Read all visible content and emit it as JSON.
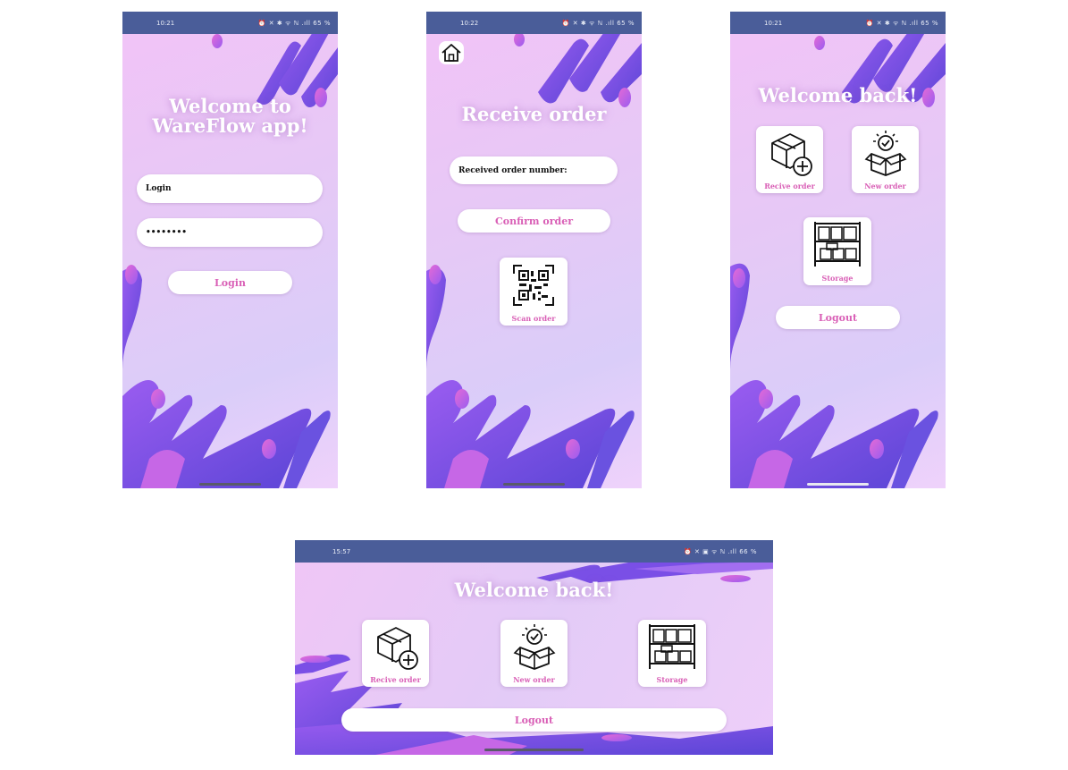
{
  "screens": {
    "login": {
      "time": "10:21",
      "status_icons": "⏰ ✕ ✱ ᯤ ℕ .ıll 65 %",
      "title_line1": "Welcome to",
      "title_line2": "WareFlow app!",
      "login_value": "Login",
      "password_value": "••••••••",
      "login_button": "Login"
    },
    "receive": {
      "time": "10:22",
      "status_icons": "⏰ ✕ ✱ ᯤ ℕ .ıll 65 %",
      "title": "Receive order",
      "order_field_label": "Received order number:",
      "confirm_button": "Confirm order",
      "scan_label": "Scan order"
    },
    "menu_portrait": {
      "time": "10:21",
      "status_icons": "⏰ ✕ ✱ ᯤ ℕ .ıll 65 %",
      "title": "Welcome back!",
      "tile_receive": "Recive order",
      "tile_new": "New order",
      "tile_storage": "Storage",
      "logout_button": "Logout"
    },
    "menu_landscape": {
      "time": "15:57",
      "status_icons": "⏰ ✕ ▣ ᯤ ℕ .ıll 66 %",
      "title": "Welcome back!",
      "tile_receive": "Recive order",
      "tile_new": "New order",
      "tile_storage": "Storage",
      "logout_button": "Logout"
    }
  },
  "colors": {
    "statusbar": "#4a5d99",
    "accent_text": "#d95fb6",
    "blob_dark": "#5b45d6",
    "blob_mid": "#8a5ae8",
    "blob_pink": "#d45fd6"
  },
  "icons": [
    "home-icon",
    "box-plus-icon",
    "open-box-check-icon",
    "storage-shelf-icon",
    "qr-code-icon"
  ]
}
